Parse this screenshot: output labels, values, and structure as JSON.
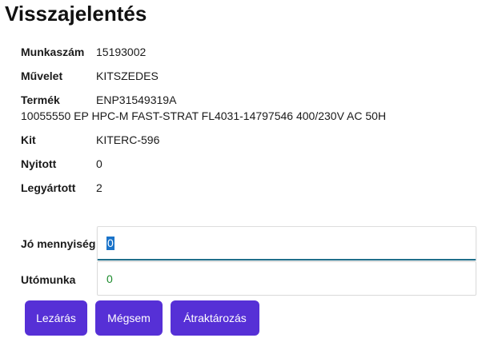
{
  "page": {
    "title": "Visszajelentés"
  },
  "details": {
    "munkaszam_label": "Munkaszám",
    "munkaszam_value": "15193002",
    "muvelet_label": "Művelet",
    "muvelet_value": "KITSZEDES",
    "termek_label": "Termék",
    "termek_value": "ENP31549319A",
    "termek_description": "10055550 EP HPC-M FAST-STRAT FL4031-14797546 400/230V AC 50H",
    "kit_label": "Kit",
    "kit_value": "KITERC-596",
    "nyitott_label": "Nyitott",
    "nyitott_value": "0",
    "legyartott_label": "Legyártott",
    "legyartott_value": "2"
  },
  "form": {
    "jo_mennyiseg_label": "Jó mennyiség",
    "jo_mennyiseg_value": "0",
    "utomunka_label": "Utómunka",
    "utomunka_value": "0"
  },
  "buttons": {
    "lezaras": "Lezárás",
    "megsem": "Mégsem",
    "atraktarozas": "Átraktározás"
  },
  "colors": {
    "button_bg": "#5630d6",
    "focus_underline": "#1f6f8b",
    "utomunka_value_text": "#1a8a2a"
  }
}
